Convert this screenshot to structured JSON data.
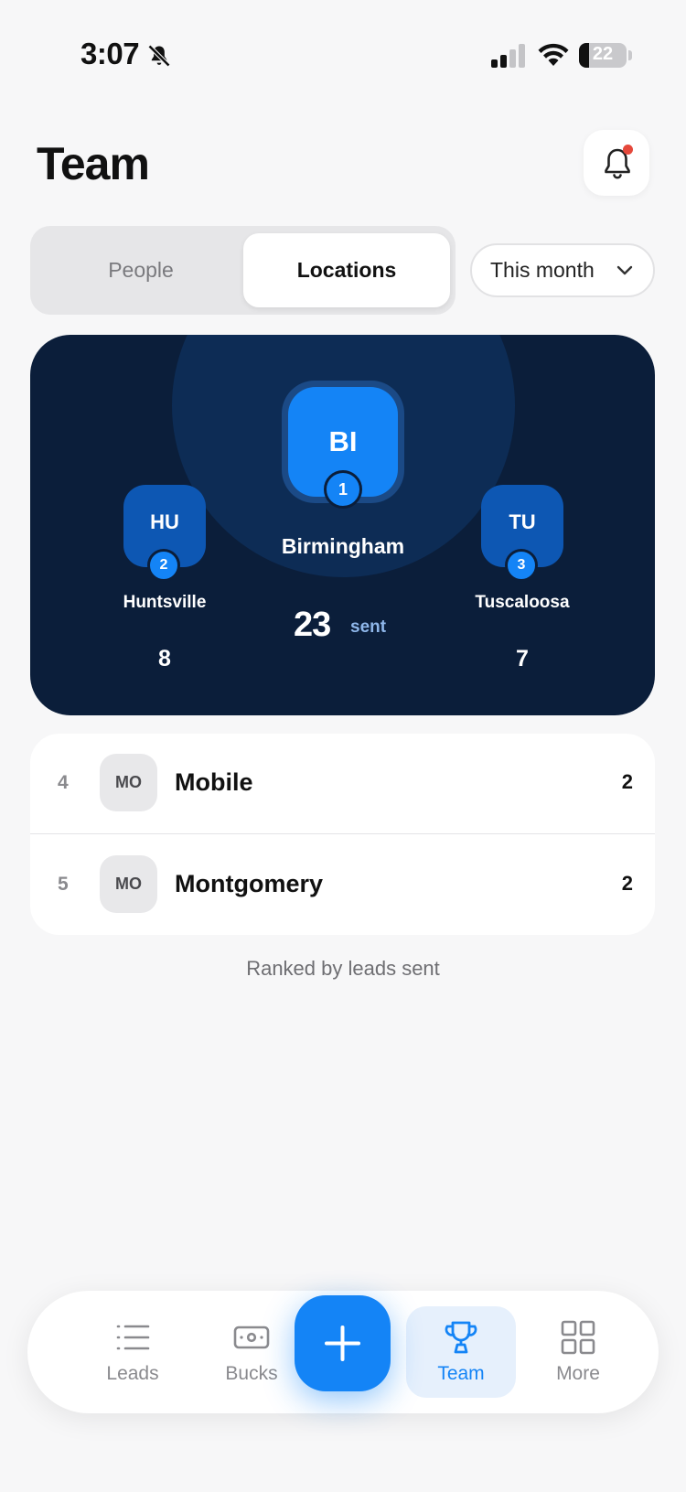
{
  "status_bar": {
    "time": "3:07",
    "battery": "22",
    "battery_level": 0.22
  },
  "header": {
    "title": "Team"
  },
  "segmented": {
    "people_label": "People",
    "locations_label": "Locations",
    "selected": "Locations"
  },
  "period": {
    "label": "This month"
  },
  "podium": {
    "first": {
      "initials": "BI",
      "rank": "1",
      "name": "Birmingham",
      "count": "23",
      "unit": "sent"
    },
    "second": {
      "initials": "HU",
      "rank": "2",
      "name": "Huntsville",
      "count": "8"
    },
    "third": {
      "initials": "TU",
      "rank": "3",
      "name": "Tuscaloosa",
      "count": "7"
    }
  },
  "rest": [
    {
      "rank": "4",
      "initials": "MO",
      "name": "Mobile",
      "count": "2"
    },
    {
      "rank": "5",
      "initials": "MO",
      "name": "Montgomery",
      "count": "2"
    }
  ],
  "footnote": "Ranked by leads sent",
  "nav": {
    "leads": "Leads",
    "bucks": "Bucks",
    "team": "Team",
    "more": "More",
    "active": "Team"
  },
  "colors": {
    "accent": "#1484f6",
    "podium_bg": "#0b1e3a",
    "notification_dot": "#e5483b"
  }
}
